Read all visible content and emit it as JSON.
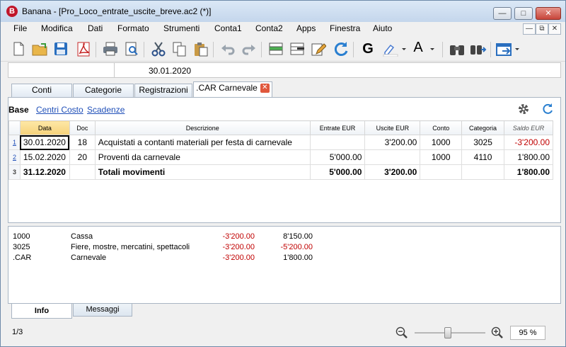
{
  "window": {
    "app_name": "Banana",
    "title": "Banana - [Pro_Loco_entrate_uscite_breve.ac2 (*)]",
    "controls": [
      "minimize",
      "maximize",
      "close"
    ]
  },
  "menu": [
    "File",
    "Modifica",
    "Dati",
    "Formato",
    "Strumenti",
    "Conta1",
    "Conta2",
    "Apps",
    "Finestra",
    "Aiuto"
  ],
  "toolbar": {
    "bold_label": "G",
    "text_color_label": "A",
    "icons": [
      "new-file-icon",
      "open-folder-icon",
      "save-icon",
      "pdf-icon",
      "print-icon",
      "print-preview-icon",
      "cut-icon",
      "copy-icon",
      "paste-icon",
      "undo-icon",
      "redo-icon",
      "insert-rows-icon",
      "delete-rows-icon",
      "edit-icon",
      "recalc-icon",
      "bold-icon",
      "highlight-icon",
      "text-color-icon",
      "find-icon",
      "find-next-icon",
      "export-icon"
    ]
  },
  "cellbar": {
    "value": "30.01.2020"
  },
  "tabs": [
    {
      "label": "Conti"
    },
    {
      "label": "Categorie"
    },
    {
      "label": "Registrazioni"
    },
    {
      "label": ".CAR Carnevale",
      "active": true,
      "closable": true
    }
  ],
  "views": [
    "Base",
    "Centri Costo",
    "Scadenze"
  ],
  "grid": {
    "headers": [
      "Data",
      "Doc",
      "Descrizione",
      "Entrate EUR",
      "Uscite EUR",
      "Conto",
      "Categoria",
      "Saldo EUR"
    ],
    "rows": [
      {
        "rn": "1",
        "data": "30.01.2020",
        "doc": "18",
        "desc": "Acquistati a contanti materiali per festa di carnevale",
        "entrate": "",
        "uscite": "3'200.00",
        "conto": "1000",
        "categoria": "3025",
        "saldo": "-3'200.00"
      },
      {
        "rn": "2",
        "data": "15.02.2020",
        "doc": "20",
        "desc": "Proventi da carnevale",
        "entrate": "5'000.00",
        "uscite": "",
        "conto": "1000",
        "categoria": "4110",
        "saldo": "1'800.00"
      },
      {
        "rn": "3",
        "data": "31.12.2020",
        "doc": "",
        "desc": "Totali movimenti",
        "entrate": "5'000.00",
        "uscite": "3'200.00",
        "conto": "",
        "categoria": "",
        "saldo": "1'800.00"
      }
    ]
  },
  "info": {
    "rows": [
      {
        "code": "1000",
        "name": "Cassa",
        "amount": "-3'200.00",
        "balance": "8'150.00"
      },
      {
        "code": "3025",
        "name": "Fiere, mostre, mercatini, spettacoli",
        "amount": "-3'200.00",
        "balance": "-5'200.00"
      },
      {
        "code": ".CAR",
        "name": "Carnevale",
        "amount": "-3'200.00",
        "balance": "1'800.00"
      }
    ]
  },
  "bottom_tabs": [
    "Info",
    "Messaggi"
  ],
  "status": {
    "page": "1/3",
    "zoom": "95 %",
    "zoom_fraction": 0.47
  },
  "colors": {
    "negative": "#c00000",
    "link": "#1f4fb8",
    "selected_header": "#f6d27a",
    "close_tab": "#e0583d"
  }
}
